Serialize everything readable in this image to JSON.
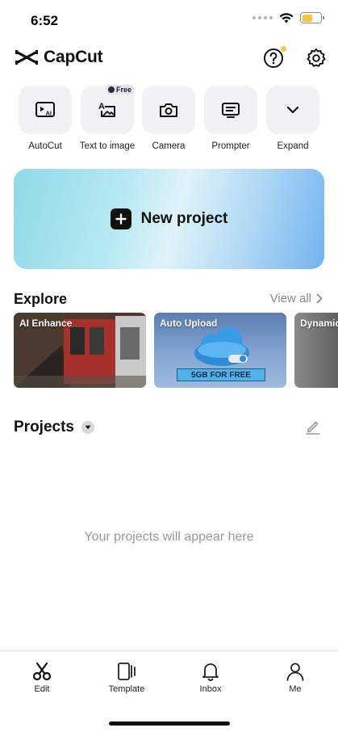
{
  "status": {
    "time": "6:52",
    "battery_color": "#f5c43a"
  },
  "header": {
    "app_name": "CapCut",
    "help_icon": "question-circle-icon",
    "settings_icon": "gear-icon",
    "notify_dot_color": "#f7c843"
  },
  "quick_actions": [
    {
      "label": "AutoCut",
      "icon": "autocut-icon"
    },
    {
      "label": "Text to image",
      "icon": "text-to-image-icon",
      "badge": "Free"
    },
    {
      "label": "Camera",
      "icon": "camera-icon"
    },
    {
      "label": "Prompter",
      "icon": "prompter-icon"
    },
    {
      "label": "Expand",
      "icon": "chevron-down-icon"
    }
  ],
  "new_project": {
    "label": "New project"
  },
  "explore": {
    "title": "Explore",
    "view_all": "View all",
    "cards": [
      {
        "label": "AI Enhance"
      },
      {
        "label": "Auto Upload",
        "overlay": "5GB FOR FREE"
      },
      {
        "label": "Dynamic"
      }
    ]
  },
  "projects": {
    "title": "Projects",
    "empty_text": "Your projects will appear here"
  },
  "tabs": [
    {
      "label": "Edit",
      "icon": "scissors-icon",
      "active": true
    },
    {
      "label": "Template",
      "icon": "template-icon"
    },
    {
      "label": "Inbox",
      "icon": "bell-icon"
    },
    {
      "label": "Me",
      "icon": "person-icon"
    }
  ]
}
